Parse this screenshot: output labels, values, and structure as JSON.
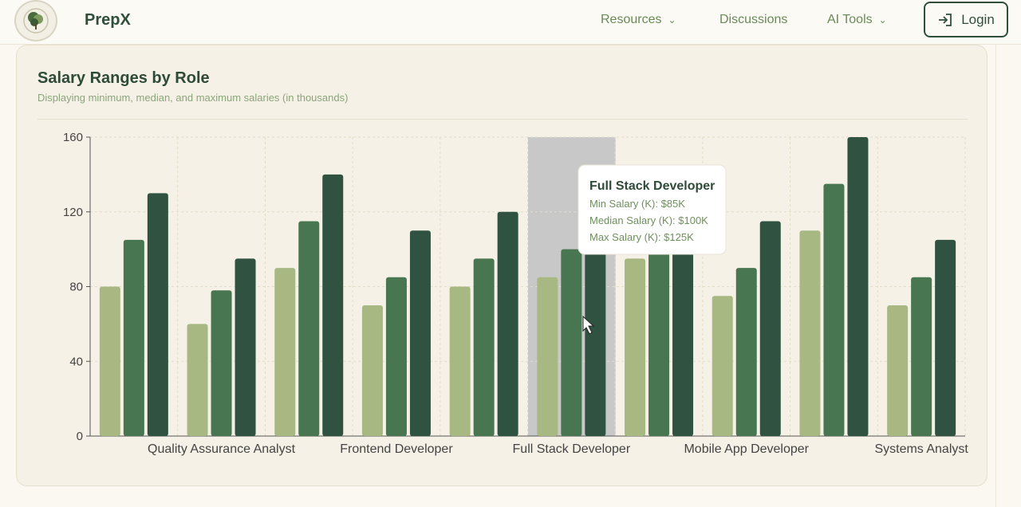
{
  "nav": {
    "brand": "PrepX",
    "resources": "Resources",
    "discussions": "Discussions",
    "ai_tools": "AI Tools",
    "login": "Login"
  },
  "card": {
    "title": "Salary Ranges by Role",
    "subtitle": "Displaying minimum, median, and maximum salaries (in thousands)"
  },
  "colors": {
    "min": "#a8b882",
    "median": "#477650",
    "max": "#2f5340",
    "highlight": "#c8c8c8",
    "grid": "#e3dcc6"
  },
  "chart_data": {
    "type": "bar",
    "categories": [
      "",
      "Quality Assurance Analyst",
      "",
      "Frontend Developer",
      "",
      "Full Stack Developer",
      "",
      "Mobile App Developer",
      "",
      "Systems Analyst"
    ],
    "series": [
      {
        "name": "Min Salary (K)",
        "values": [
          80,
          60,
          90,
          70,
          80,
          85,
          95,
          75,
          110,
          70
        ]
      },
      {
        "name": "Median Salary (K)",
        "values": [
          105,
          78,
          115,
          85,
          95,
          100,
          115,
          90,
          135,
          85
        ]
      },
      {
        "name": "Max Salary (K)",
        "values": [
          130,
          95,
          140,
          110,
          120,
          125,
          145,
          115,
          160,
          105
        ]
      }
    ],
    "ylim": [
      0,
      160
    ],
    "yticks": [
      0,
      40,
      80,
      120,
      160
    ],
    "grid": true,
    "highlighted_index": 5,
    "tooltip": {
      "title": "Full Stack Developer",
      "lines": [
        "Min Salary (K): $85K",
        "Median Salary (K): $100K",
        "Max Salary (K): $125K"
      ]
    }
  }
}
